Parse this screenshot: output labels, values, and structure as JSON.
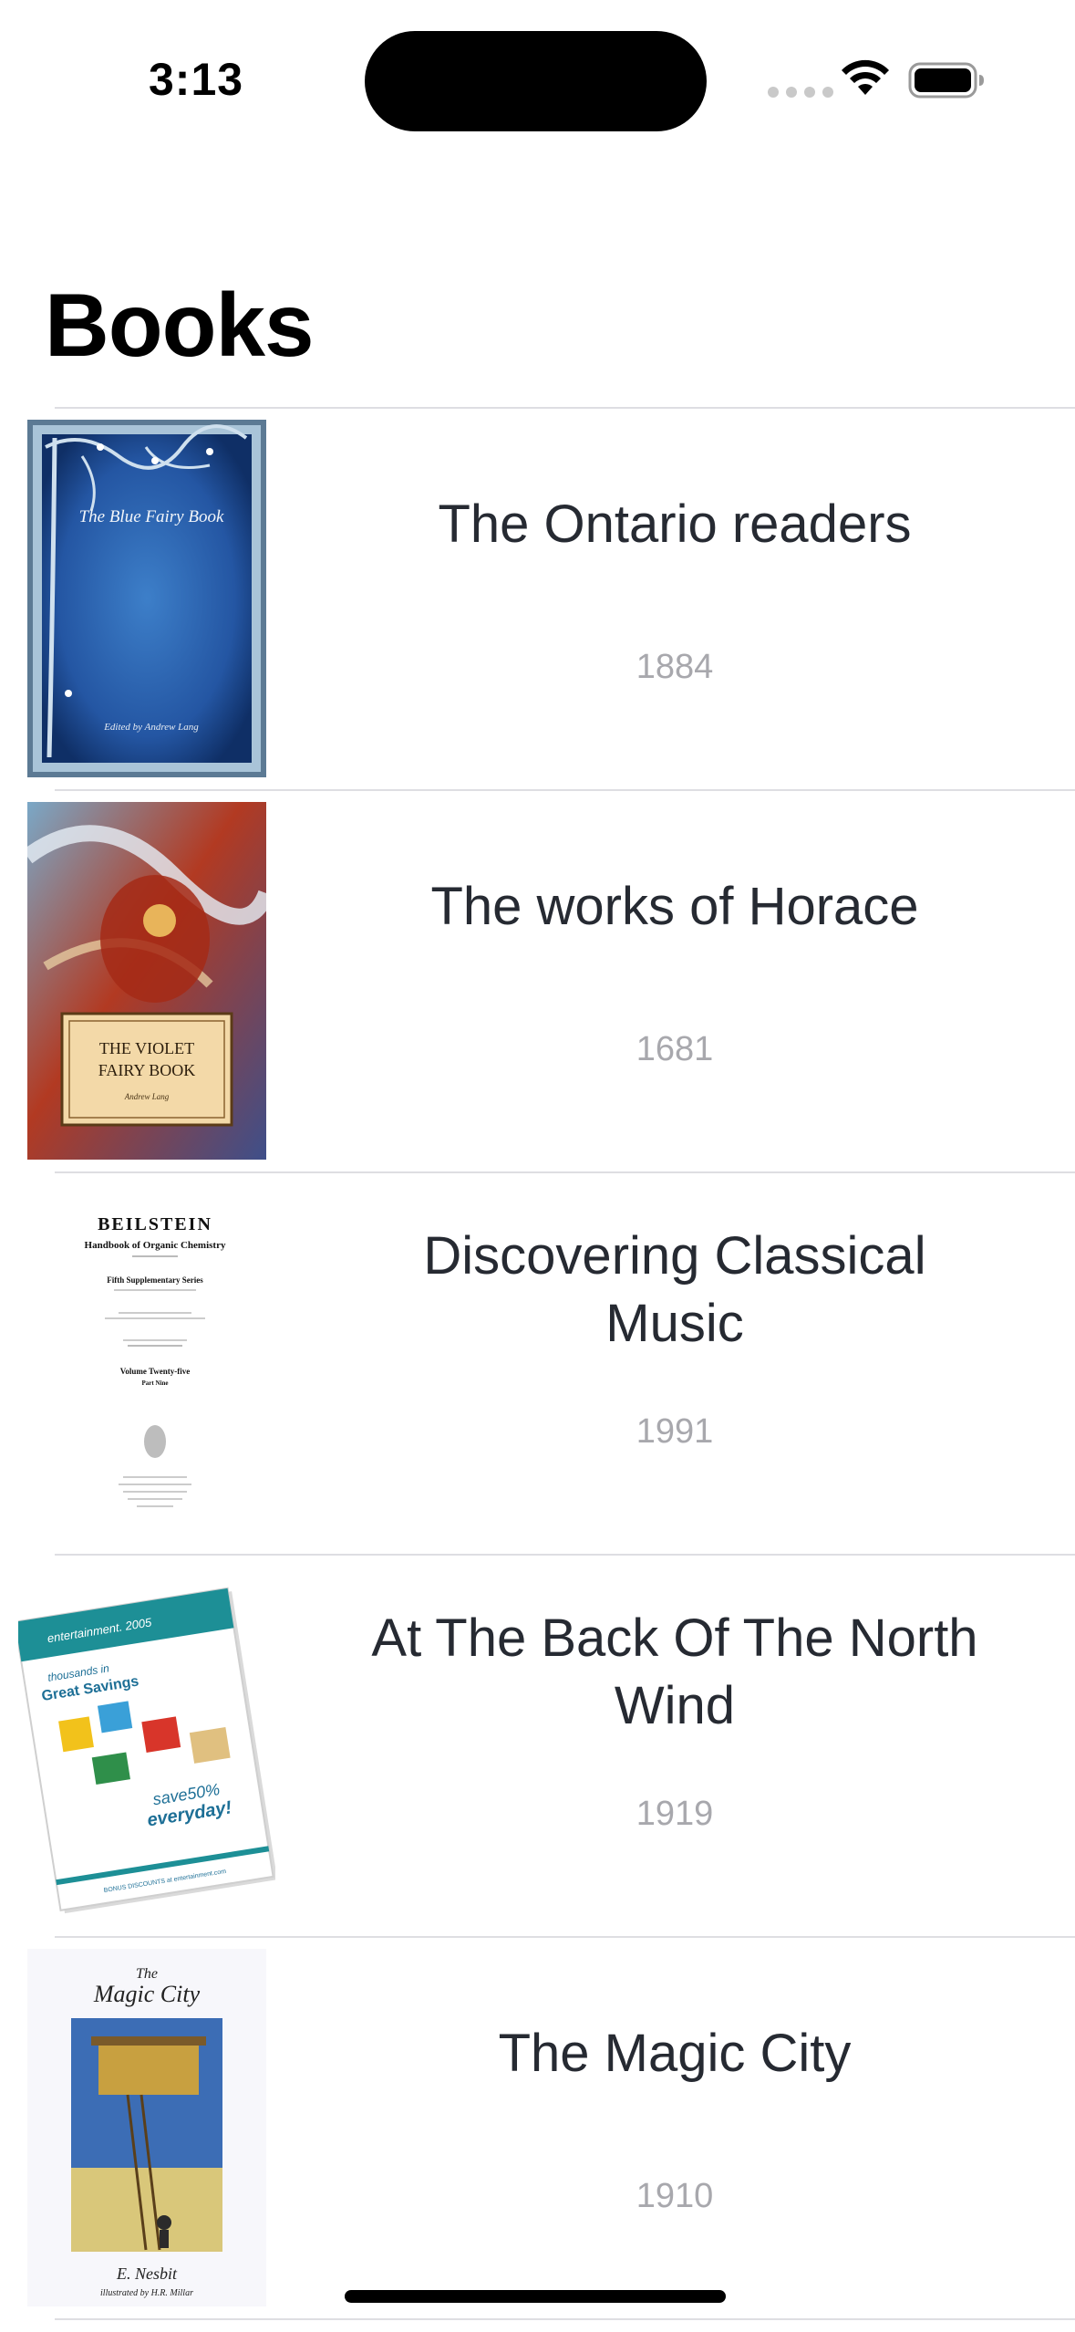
{
  "status_bar": {
    "time": "3:13"
  },
  "page": {
    "title": "Books"
  },
  "books": [
    {
      "title": "The Ontario readers",
      "year": "1884",
      "cover": {
        "title": "The Blue Fairy Book",
        "subtitle": "Edited by Andrew Lang"
      }
    },
    {
      "title": "The works of Horace",
      "year": "1681",
      "cover": {
        "title": "THE VIOLET FAIRY BOOK",
        "subtitle": "Andrew Lang"
      }
    },
    {
      "title": "Discovering Classical Music",
      "year": "1991",
      "cover": {
        "title": "BEILSTEIN",
        "subtitle": "Handbook of Organic Chemistry",
        "series": "Fifth Supplementary Series",
        "volume": "Volume Twenty-five",
        "part": "Part Nine"
      }
    },
    {
      "title": "At The Back Of The North Wind",
      "year": "1919",
      "cover": {
        "brand": "entertainment. 2005",
        "headline": "Great Savings",
        "kicker": "thousands in",
        "promo_1": "save50%",
        "promo_2": "everyday!",
        "footer": "BONUS DISCOUNTS at entertainment.com"
      }
    },
    {
      "title": "The Magic City",
      "year": "1910",
      "cover": {
        "the": "The",
        "title": "Magic City",
        "author": "E. Nesbit",
        "illustrator": "illustrated by H.R. Millar"
      }
    }
  ],
  "colors": {
    "accent_text": "#262a32",
    "secondary_text": "#a8a8ad",
    "divider": "#dedee2"
  }
}
